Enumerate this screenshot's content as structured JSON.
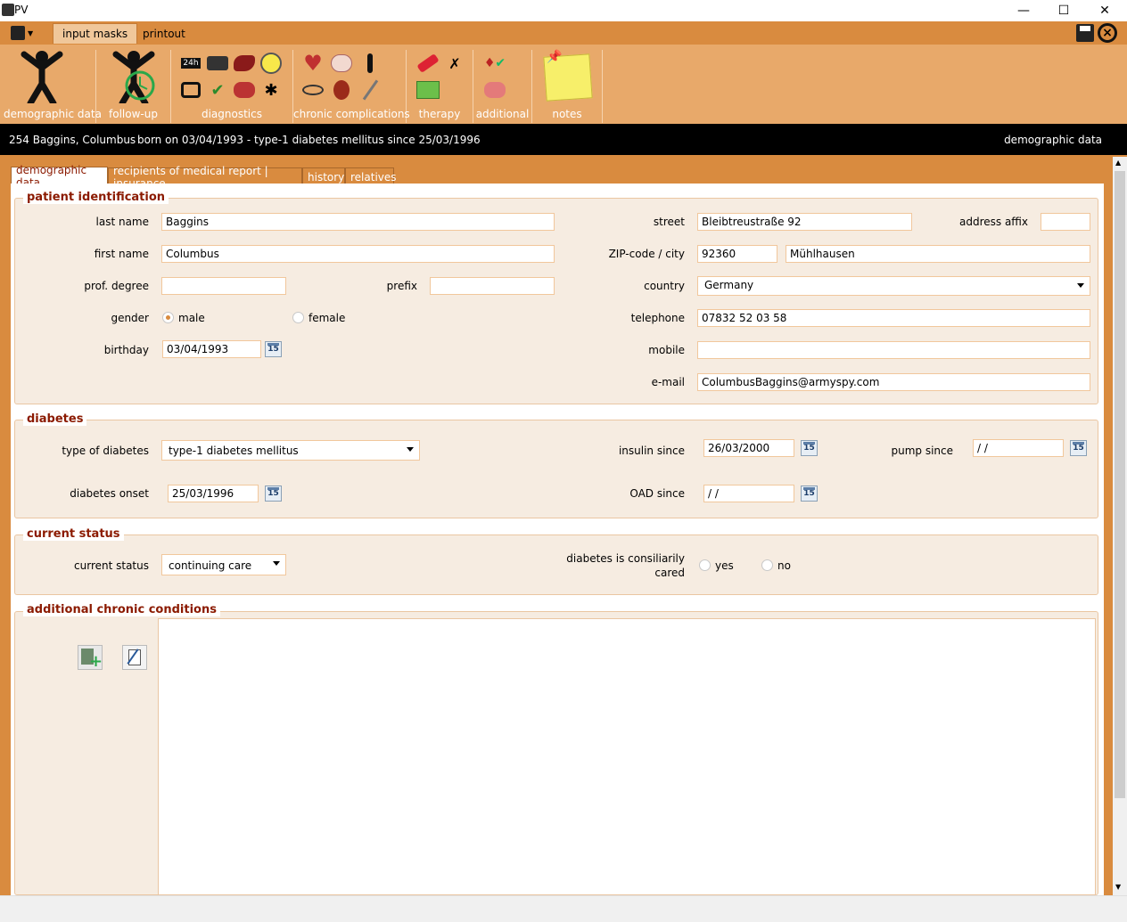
{
  "window": {
    "title": "PV",
    "minimize": "—",
    "maximize": "☐",
    "close": "✕"
  },
  "menu": {
    "app_icon": "app-logo-icon",
    "tabs": [
      "input masks",
      "printout"
    ],
    "save_icon": "save-icon",
    "exit_icon": "exit-icon"
  },
  "ribbon": {
    "groups": [
      {
        "label": "demographic data"
      },
      {
        "label": "follow-up"
      },
      {
        "label": "diagnostics"
      },
      {
        "label": "chronic complications"
      },
      {
        "label": "therapy"
      },
      {
        "label": "additional"
      },
      {
        "label": "notes"
      }
    ]
  },
  "info": {
    "patient": "254 Baggins, Columbus",
    "details": "born on 03/04/1993 - type-1 diabetes mellitus since 25/03/1996",
    "section": "demographic data"
  },
  "subtabs": [
    "demographic data",
    "recipients of medical report | insurance",
    "history",
    "relatives"
  ],
  "patient_identification": {
    "title": "patient identification",
    "last_name_label": "last name",
    "last_name": "Baggins",
    "first_name_label": "first name",
    "first_name": "Columbus",
    "prof_degree_label": "prof. degree",
    "prof_degree": "",
    "prefix_label": "prefix",
    "prefix": "",
    "gender_label": "gender",
    "gender_male": "male",
    "gender_female": "female",
    "gender_selected": "male",
    "birthday_label": "birthday",
    "birthday": "03/04/1993",
    "street_label": "street",
    "street": "Bleibtreustraße 92",
    "address_affix_label": "address affix",
    "address_affix": "",
    "zip_city_label": "ZIP-code / city",
    "zip": "92360",
    "city": "Mühlhausen",
    "country_label": "country",
    "country": "Germany",
    "telephone_label": "telephone",
    "telephone": "07832 52 03 58",
    "mobile_label": "mobile",
    "mobile": "",
    "email_label": "e-mail",
    "email": "ColumbusBaggins@armyspy.com"
  },
  "diabetes": {
    "title": "diabetes",
    "type_label": "type of diabetes",
    "type": "type-1 diabetes mellitus",
    "insulin_since_label": "insulin since",
    "insulin_since": "26/03/2000",
    "pump_since_label": "pump since",
    "pump_since": " /  /",
    "onset_label": "diabetes onset",
    "onset": "25/03/1996",
    "oad_since_label": "OAD since",
    "oad_since": " /  /",
    "calendar_text": "15"
  },
  "current_status": {
    "title": "current status",
    "status_label": "current status",
    "status": "continuing care",
    "consiliar_label_1": "diabetes is consiliarily",
    "consiliar_label_2": "cared",
    "yes": "yes",
    "no": "no"
  },
  "additional_chronic": {
    "title": "additional chronic conditions"
  },
  "colors": {
    "accent": "#d98b3f",
    "ribbon": "#e8a96a",
    "group_title": "#8b1a00",
    "panel": "#f6ece1"
  }
}
